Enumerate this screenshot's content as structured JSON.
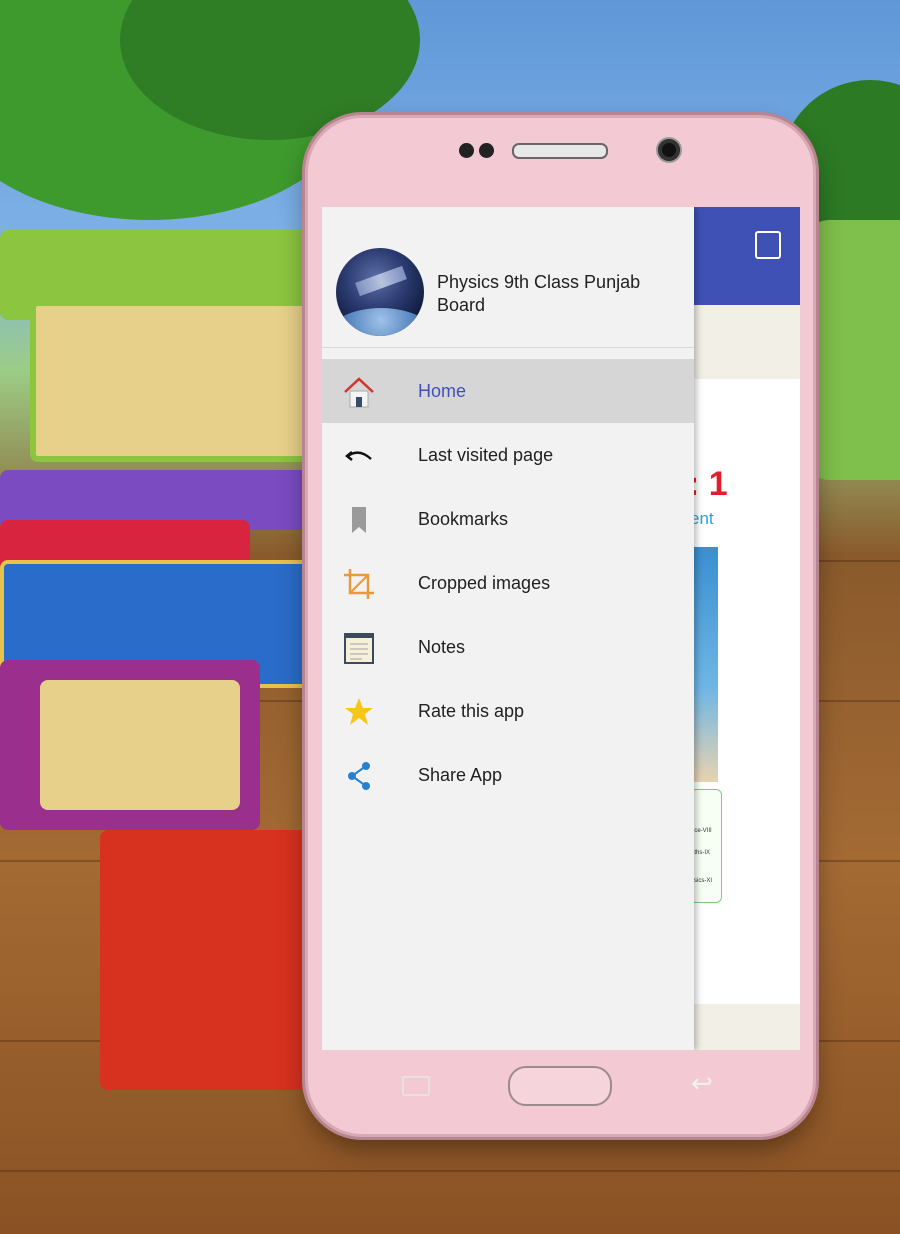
{
  "colors": {
    "accent": "#3f51b5",
    "active_row": "#d6d6d6",
    "phone_body": "#f3c9d3",
    "chapter_red": "#e51d2a",
    "chapter_blue": "#1ca7d6"
  },
  "drawer": {
    "app_title": "Physics 9th Class Punjab Board",
    "avatar_icon": "satellite-avatar",
    "items": [
      {
        "label": "Home",
        "icon": "home-icon",
        "active": true
      },
      {
        "label": "Last visited page",
        "icon": "undo-icon",
        "active": false
      },
      {
        "label": "Bookmarks",
        "icon": "bookmark-icon",
        "active": false
      },
      {
        "label": "Cropped images",
        "icon": "crop-icon",
        "active": false
      },
      {
        "label": "Notes",
        "icon": "notes-icon",
        "active": false
      },
      {
        "label": "Rate this app",
        "icon": "star-icon",
        "active": false
      },
      {
        "label": "Share App",
        "icon": "share-icon",
        "active": false
      }
    ]
  },
  "background_content": {
    "chapter_number": ": 1",
    "chapter_subtitle": "ent",
    "course_lines": [
      "nce-VIII",
      "aths-IX",
      "ysics-XI"
    ]
  }
}
